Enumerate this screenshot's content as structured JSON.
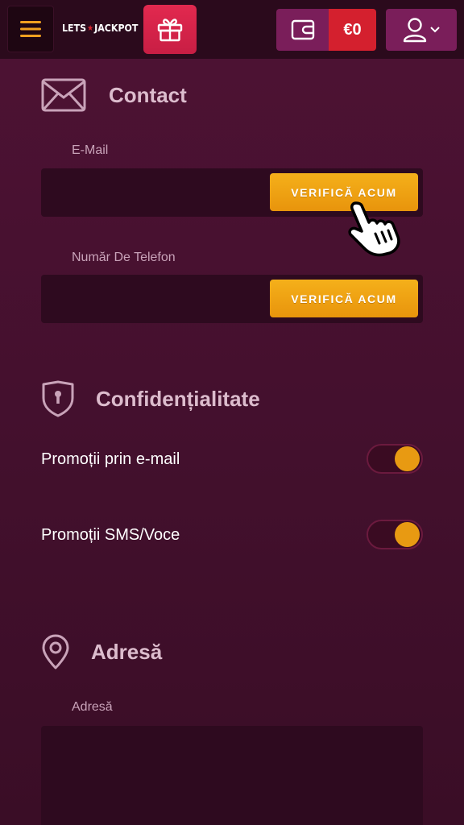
{
  "header": {
    "logo_left": "LETS",
    "logo_star": "★",
    "logo_right": "JACKPOT",
    "balance": "€0",
    "menu_icon": "hamburger-icon",
    "gift_icon": "gift-icon",
    "wallet_icon": "wallet-icon",
    "account_icon": "user-icon"
  },
  "contact": {
    "title": "Contact",
    "icon": "envelope-icon",
    "email_label": "E-Mail",
    "email_value": "",
    "email_verify": "VERIFICĂ ACUM",
    "phone_label": "Număr De Telefon",
    "phone_value": "",
    "phone_verify": "VERIFICĂ ACUM"
  },
  "privacy": {
    "title": "Confidențialitate",
    "icon": "shield-lock-icon",
    "email_promo_label": "Promoții prin e-mail",
    "email_promo_on": true,
    "sms_promo_label": "Promoții SMS/Voce",
    "sms_promo_on": true
  },
  "address": {
    "title": "Adresă",
    "icon": "map-pin-icon",
    "field_label": "Adresă",
    "value": ""
  },
  "colors": {
    "accent": "#e89a12",
    "gift": "#d8234a",
    "balance": "#d4202e",
    "background": "#4a1131"
  }
}
